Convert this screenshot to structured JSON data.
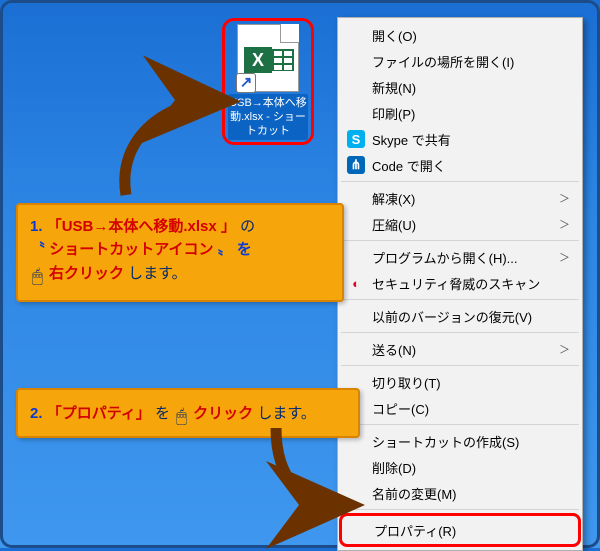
{
  "shortcut": {
    "glyph": "X",
    "filename": "USB→本体へ移動.xlsx - ショートカット"
  },
  "menu": [
    {
      "t": "item",
      "label": "開く(O)"
    },
    {
      "t": "item",
      "label": "ファイルの場所を開く(I)"
    },
    {
      "t": "item",
      "label": "新規(N)"
    },
    {
      "t": "item",
      "label": "印刷(P)"
    },
    {
      "t": "item",
      "label": "Skype で共有",
      "icon": "skype",
      "glyph": "S"
    },
    {
      "t": "item",
      "label": "Code で開く",
      "icon": "vsc",
      "glyph": "⋔"
    },
    {
      "t": "sep"
    },
    {
      "t": "item",
      "label": "解凍(X)",
      "sub": true
    },
    {
      "t": "item",
      "label": "圧縮(U)",
      "sub": true
    },
    {
      "t": "sep"
    },
    {
      "t": "item",
      "label": "プログラムから開く(H)...",
      "sub": true
    },
    {
      "t": "item",
      "label": "セキュリティ脅威のスキャン",
      "icon": "trend",
      "glyph": "◐"
    },
    {
      "t": "sep"
    },
    {
      "t": "item",
      "label": "以前のバージョンの復元(V)"
    },
    {
      "t": "sep"
    },
    {
      "t": "item",
      "label": "送る(N)",
      "sub": true
    },
    {
      "t": "sep"
    },
    {
      "t": "item",
      "label": "切り取り(T)"
    },
    {
      "t": "item",
      "label": "コピー(C)"
    },
    {
      "t": "sep"
    },
    {
      "t": "item",
      "label": "ショートカットの作成(S)"
    },
    {
      "t": "item",
      "label": "削除(D)"
    },
    {
      "t": "item",
      "label": "名前の変更(M)"
    },
    {
      "t": "sep"
    },
    {
      "t": "item",
      "label": "プロパティ(R)",
      "highlight": true
    }
  ],
  "callout1": {
    "num": "1.",
    "l1a": "「USB→本体へ移動.xlsx 」",
    "l1b": "の",
    "l2a": "〝",
    "l2b": "ショートカットアイコン",
    "l2c": "〟 を",
    "l3a": "右クリック",
    "l3b": "します。"
  },
  "callout2": {
    "num": "2.",
    "a": "「プロパティ」",
    "b": "を",
    "c": "クリック",
    "d": "します。"
  },
  "submenuGlyph": "＞",
  "mouseGlyph": "🖱",
  "shortcutArrowGlyph": "↗"
}
